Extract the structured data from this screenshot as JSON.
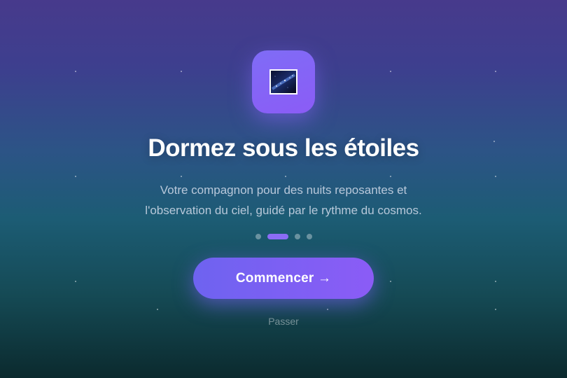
{
  "onboarding": {
    "title": "Dormez sous les étoiles",
    "subtitle_line1": "Votre compagnon pour des nuits reposantes et",
    "subtitle_line2": "l'observation du ciel, guidé par le rythme du cosmos.",
    "pagination": {
      "total": 4,
      "current": 2
    },
    "cta_label": "Commencer →",
    "skip_label": "Passer"
  },
  "icons": {
    "app": "starry-sky-image-icon"
  },
  "colors": {
    "accent": "#8b5cf6",
    "background_top": "#473a8c",
    "background_bottom": "#0b2a2e"
  }
}
